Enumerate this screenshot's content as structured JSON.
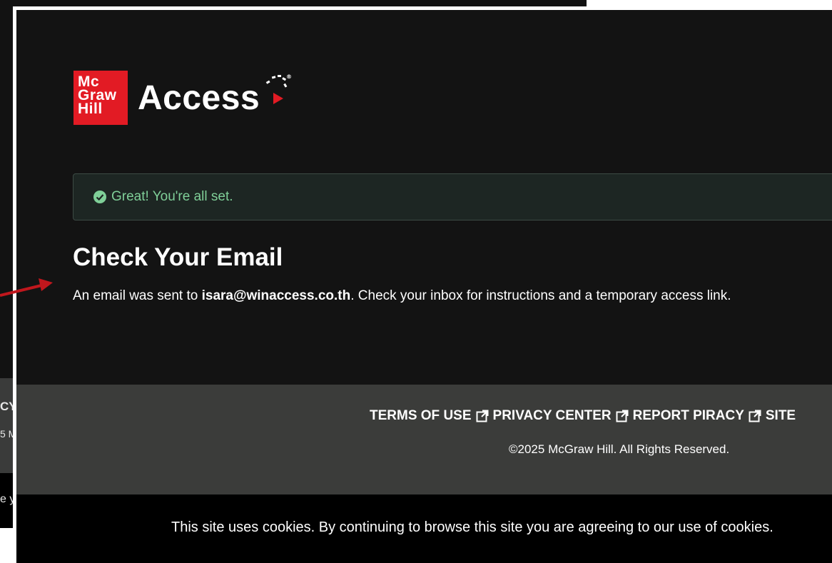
{
  "background_window": {
    "footer_fragment": "CY",
    "copyright_fragment": "5 M",
    "cookie_fragment": "e y"
  },
  "logo": {
    "brand_lines": [
      "Mc",
      "Graw",
      "Hill"
    ],
    "product": "Access",
    "registered": "®",
    "brand_color": "#e21b24"
  },
  "alert": {
    "icon": "check-circle-icon",
    "text": "Great! You're all set."
  },
  "main": {
    "title": "Check Your Email",
    "message_prefix": "An email was sent to ",
    "email": "isara@winaccess.co.th",
    "message_suffix": ". Check your inbox for instructions and a temporary access link."
  },
  "footer": {
    "links": [
      {
        "label": "TERMS OF USE",
        "icon": "external-link-icon"
      },
      {
        "label": "PRIVACY CENTER",
        "icon": "external-link-icon"
      },
      {
        "label": "REPORT PIRACY",
        "icon": "external-link-icon"
      },
      {
        "label": "SITE",
        "icon": "external-link-icon"
      }
    ],
    "copyright": "©2025 McGraw Hill. All Rights Reserved."
  },
  "cookie_banner": {
    "text": "This site uses cookies. By continuing to browse this site you are agreeing to our use of cookies."
  },
  "annotation": {
    "arrow_color": "#c0171d"
  }
}
